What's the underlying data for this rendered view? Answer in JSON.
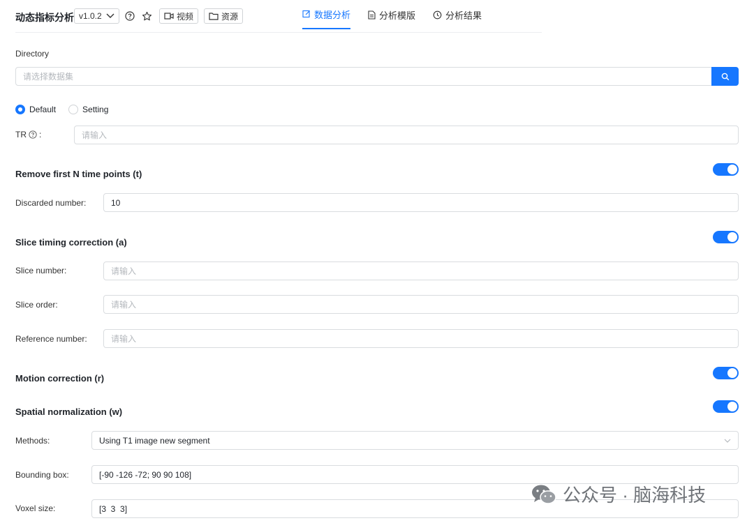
{
  "header": {
    "app_title": "动态指标分析",
    "version": "v1.0.2",
    "video_label": "视频",
    "resource_label": "资源",
    "tabs": [
      {
        "label": "数据分析"
      },
      {
        "label": "分析模版"
      },
      {
        "label": "分析结果"
      }
    ]
  },
  "directory": {
    "label": "Directory",
    "placeholder": "请选择数据集"
  },
  "mode": {
    "options": [
      "Default",
      "Setting"
    ],
    "selected": "Default"
  },
  "tr": {
    "label": "TR",
    "placeholder": "请输入"
  },
  "remove_first": {
    "title": "Remove first N time points (t)",
    "enabled": true,
    "discarded_label": "Discarded number:",
    "discarded_value": "10"
  },
  "slice_timing": {
    "title": "Slice timing correction (a)",
    "enabled": true,
    "fields": [
      {
        "label": "Slice number:",
        "placeholder": "请输入"
      },
      {
        "label": "Slice order:",
        "placeholder": "请输入"
      },
      {
        "label": "Reference number:",
        "placeholder": "请输入"
      }
    ]
  },
  "motion": {
    "title": "Motion correction (r)",
    "enabled": true
  },
  "spatial": {
    "title": "Spatial normalization (w)",
    "enabled": true,
    "methods_label": "Methods:",
    "methods_value": "Using T1 image new segment",
    "bbox_label": "Bounding box:",
    "bbox_value": "[-90 -126 -72; 90 90 108]",
    "voxel_label": "Voxel size:",
    "voxel_value": "[3  3  3]"
  },
  "watermark": "公众号 · 脑海科技",
  "colors": {
    "accent": "#1677ff"
  }
}
